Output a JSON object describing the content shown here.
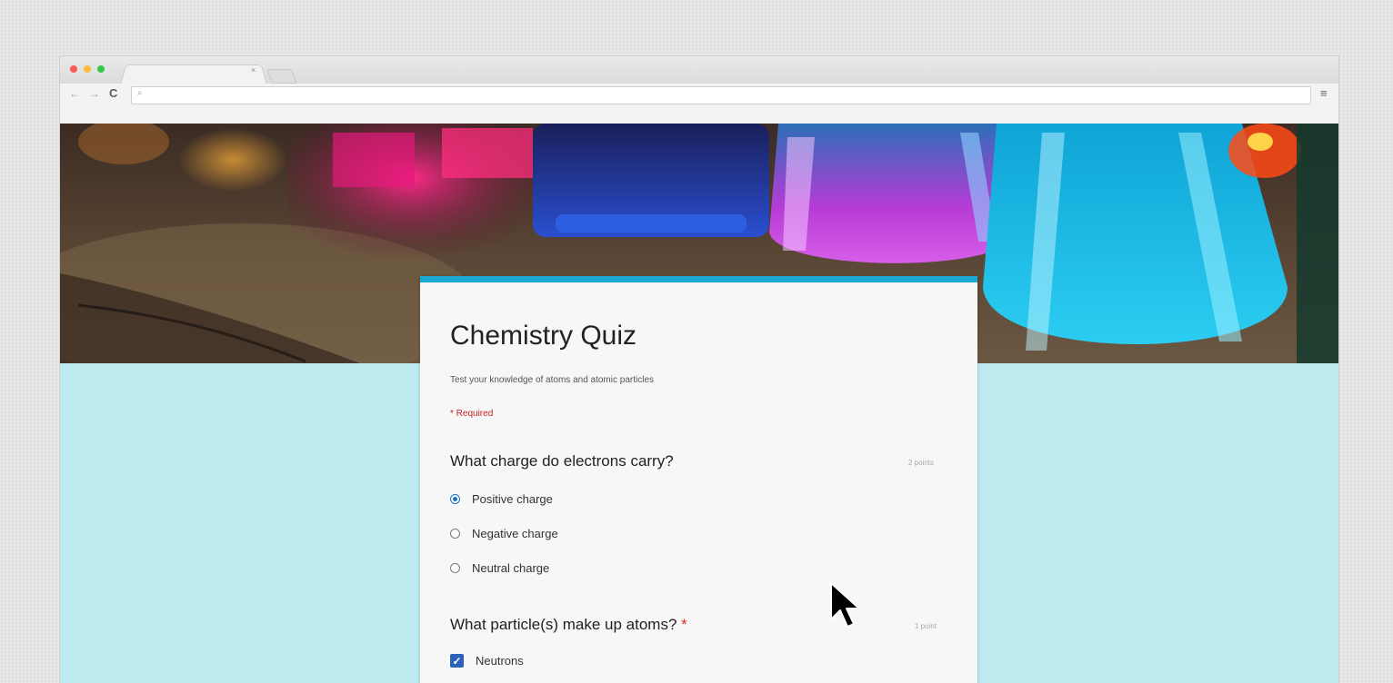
{
  "browser": {
    "tab_close_glyph": "×",
    "nav_back_glyph": "←",
    "nav_forward_glyph": "→",
    "nav_reload_glyph": "C",
    "search_glyph": "⌕",
    "menu_glyph": "≡"
  },
  "form": {
    "title": "Chemistry Quiz",
    "description": "Test your knowledge of atoms and atomic particles",
    "required_note": "* Required",
    "accent_color": "#1aa8d5",
    "questions": [
      {
        "text": "What charge do electrons carry?",
        "points": "2 points",
        "required": false,
        "options": [
          {
            "label": "Positive charge",
            "selected": true
          },
          {
            "label": "Negative charge",
            "selected": false
          },
          {
            "label": "Neutral charge",
            "selected": false
          }
        ]
      },
      {
        "text": "What particle(s) make up atoms?",
        "required_marker": "*",
        "points": "1 point",
        "required": true,
        "options": [
          {
            "label": "Neutrons",
            "checked": true
          },
          {
            "label": "",
            "checked": true
          }
        ]
      }
    ]
  },
  "icons": {
    "radio_checked": "radio-checked-icon",
    "radio_unchecked": "radio-unchecked-icon",
    "checkbox_checked": "checkbox-checked-icon",
    "cursor": "mouse-pointer-icon",
    "checkmark_glyph": "✓"
  }
}
